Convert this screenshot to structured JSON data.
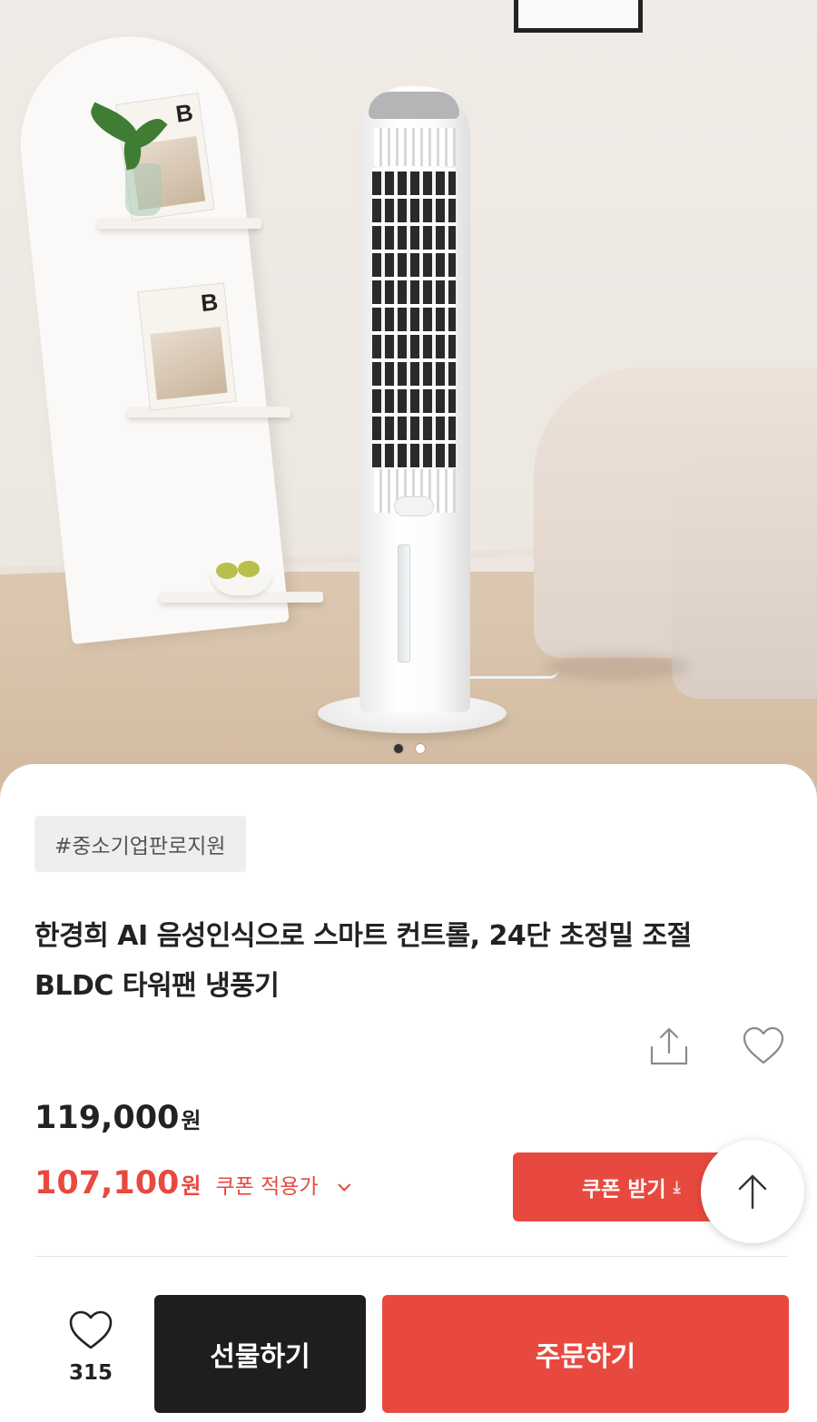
{
  "gallery": {
    "total_images": 2,
    "active_index": 0
  },
  "product": {
    "tag": "#중소기업판로지원",
    "title_line1": "한경희 AI 음성인식으로 스마트 컨트롤, 24단 초정밀 조절",
    "title_line2": "BLDC 타워팬 냉풍기",
    "original_price": "119,000",
    "sale_price": "107,100",
    "currency": "원",
    "coupon_note": "쿠폰 적용가"
  },
  "actions": {
    "coupon_button": "쿠폰 받기",
    "wish_count": "315",
    "gift_button": "선물하기",
    "order_button": "주문하기"
  },
  "icons": {
    "share": "share-icon",
    "wishlist": "heart-icon",
    "scroll_top": "arrow-up-icon",
    "coupon_chevron": "chevron-down-icon",
    "coupon_download": "download-icon"
  },
  "colors": {
    "accent": "#e8493f",
    "dark_button": "#1e1e1e",
    "tag_background": "#eeeeee"
  }
}
